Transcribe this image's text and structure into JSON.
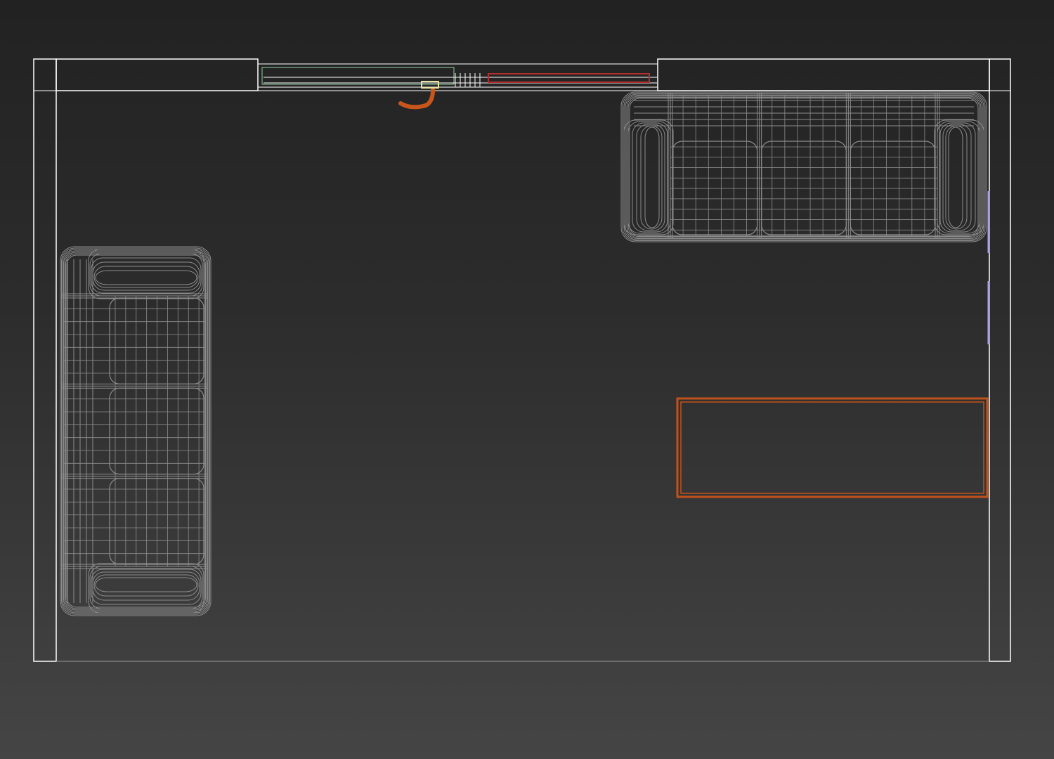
{
  "viewport": {
    "label": "",
    "background_top": "#222222",
    "background_bottom": "#454545"
  },
  "colors": {
    "wall_wire": "#ffffff",
    "sofa_wire": "#8c8c8c",
    "window_frame_green": "#8fd19e",
    "window_red_panel": "#b03030",
    "door_handle_orange": "#c8561c",
    "handle_highlight": "#e8e4a0",
    "rug_orange": "#c0521c",
    "wall_light_blue": "#a9a4e0"
  },
  "objects": [
    {
      "name": "room-walls",
      "type": "wall",
      "selected": false
    },
    {
      "name": "sliding-window",
      "type": "window",
      "selected": false
    },
    {
      "name": "door-handle",
      "type": "handle",
      "selected": false
    },
    {
      "name": "sofa-top-right",
      "type": "sofa",
      "seats": 3,
      "selected": false
    },
    {
      "name": "sofa-left",
      "type": "sofa",
      "seats": 3,
      "selected": false
    },
    {
      "name": "rug",
      "type": "rectangle",
      "selected": false
    },
    {
      "name": "wall-light",
      "type": "light",
      "selected": false
    }
  ]
}
